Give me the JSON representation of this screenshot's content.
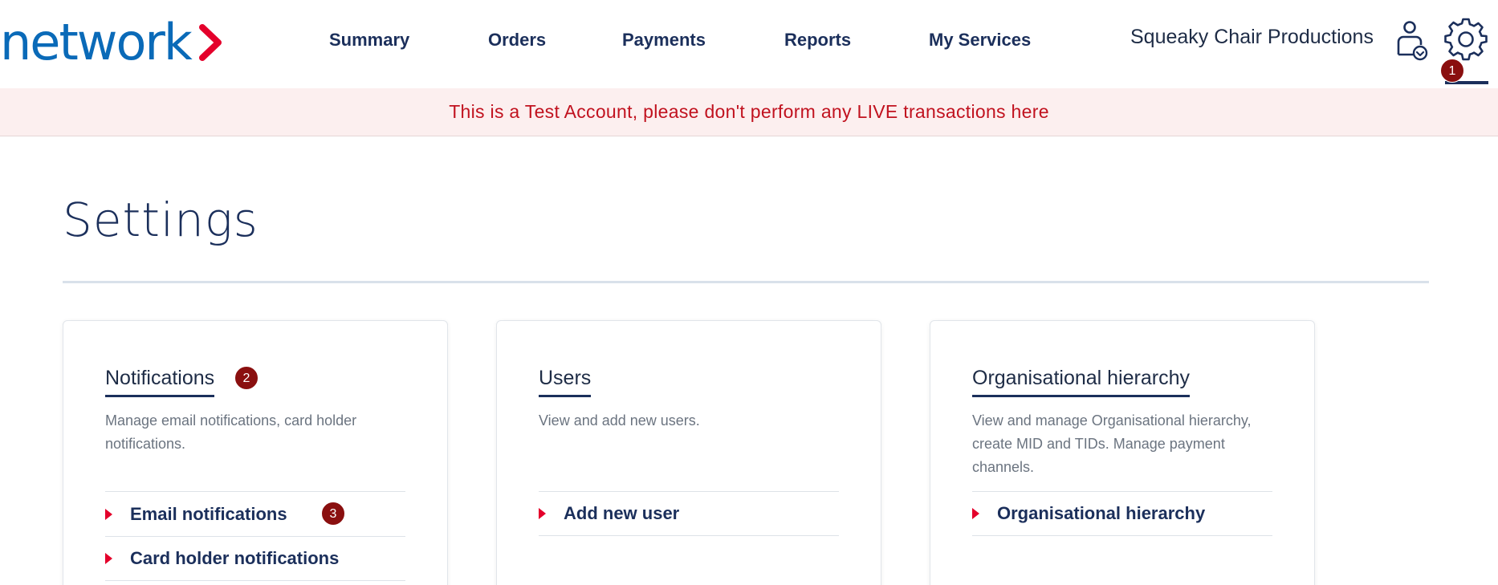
{
  "header": {
    "logo_text": "network",
    "nav": [
      {
        "label": "Summary"
      },
      {
        "label": "Orders"
      },
      {
        "label": "Payments"
      },
      {
        "label": "Reports"
      },
      {
        "label": "My Services"
      }
    ],
    "company_name": "Squeaky Chair Productions",
    "user_icon": "user-profile-icon",
    "settings_icon": "gear-icon"
  },
  "badges": {
    "one": "1",
    "two": "2",
    "three": "3"
  },
  "banner": {
    "text": "This is a Test Account, please don't perform any LIVE transactions here"
  },
  "page": {
    "title": "Settings"
  },
  "cards": [
    {
      "title": "Notifications",
      "description": "Manage email notifications, card holder notifications.",
      "links": [
        {
          "label": "Email notifications"
        },
        {
          "label": "Card holder notifications"
        }
      ]
    },
    {
      "title": "Users",
      "description": "View and add new users.",
      "links": [
        {
          "label": "Add new user"
        }
      ]
    },
    {
      "title": "Organisational hierarchy",
      "description": "View and manage Organisational hierarchy, create MID and TIDs. Manage payment channels.",
      "links": [
        {
          "label": "Organisational hierarchy"
        }
      ]
    }
  ],
  "colors": {
    "brand_blue": "#0a6ab8",
    "brand_red": "#e4002b",
    "navy": "#1b2f5b",
    "banner_bg": "#fcefef",
    "banner_text": "#c1121f",
    "badge": "#8a0f0f"
  }
}
